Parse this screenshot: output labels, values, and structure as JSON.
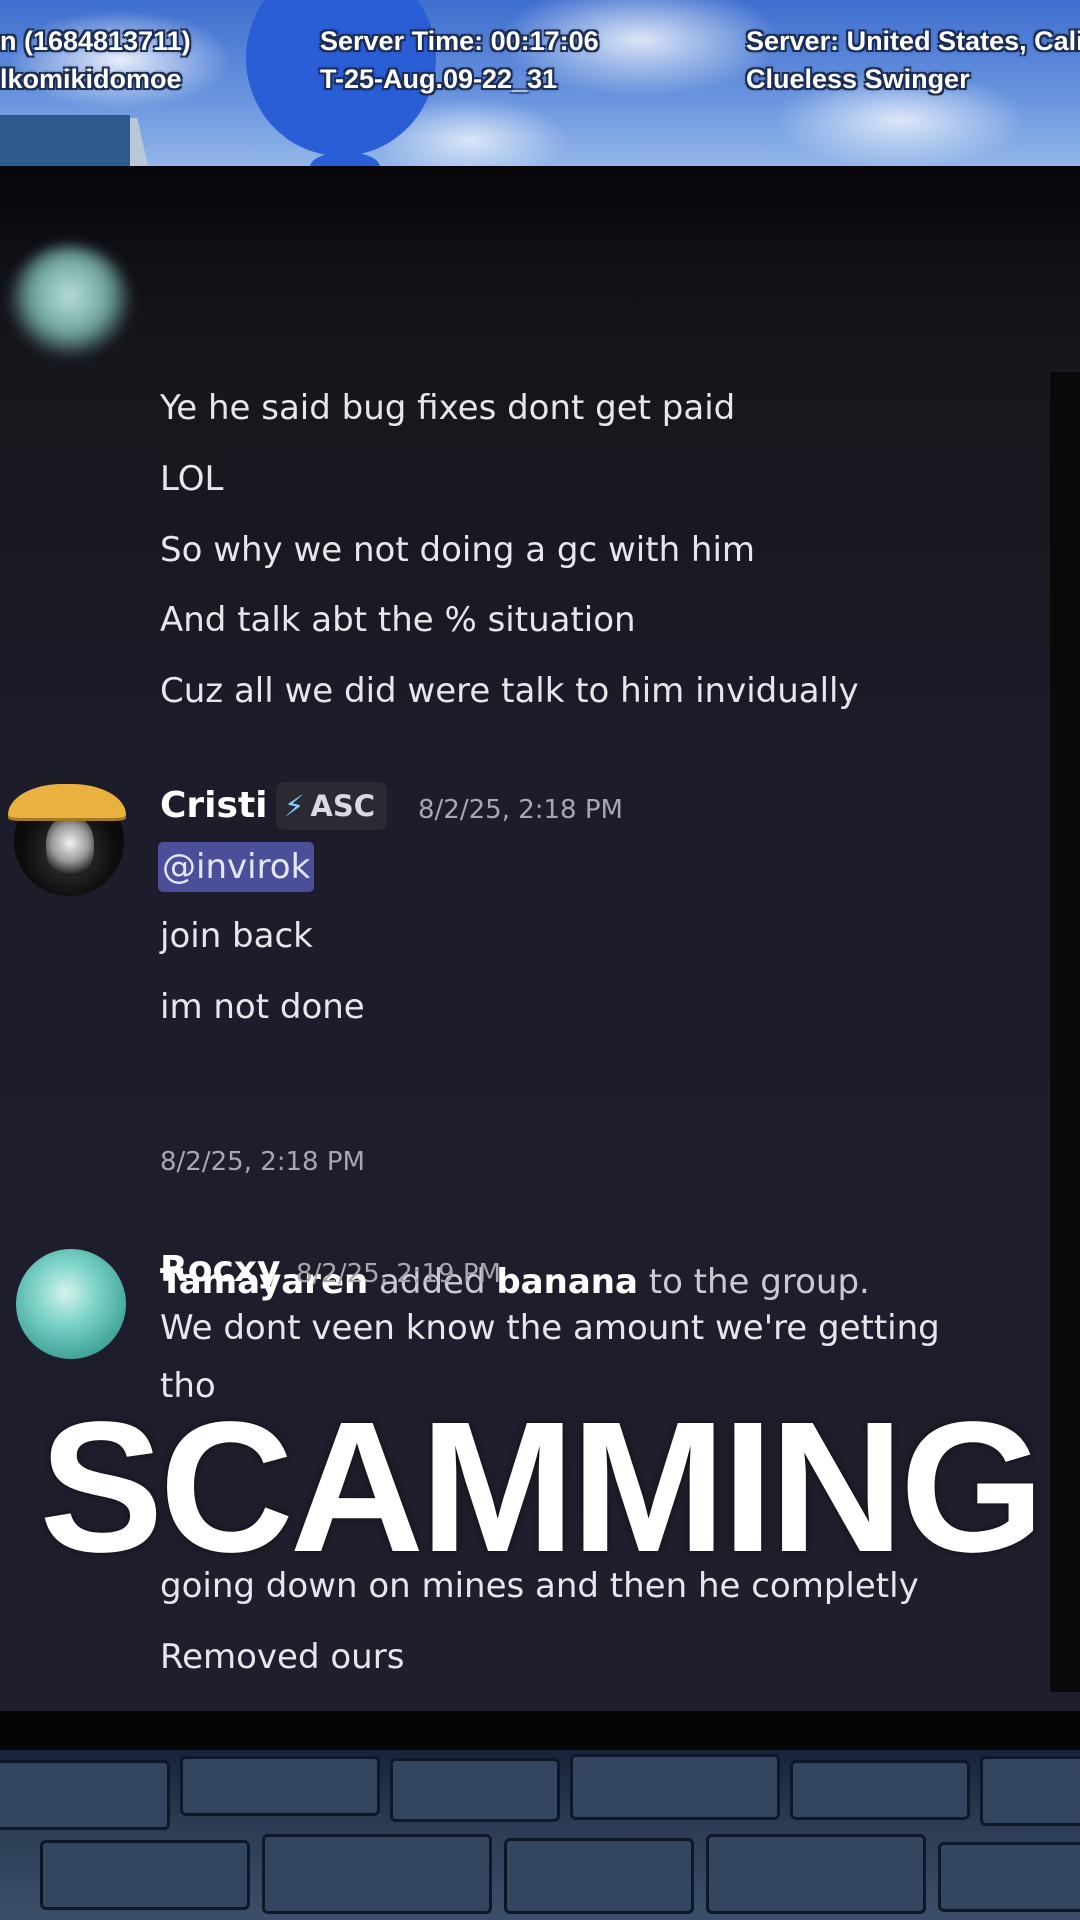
{
  "hud": {
    "left_line1": "n (1684813711)",
    "left_line2": "lkomikidomoe",
    "server_time": "Server Time: 00:17:06",
    "build": "T-25-Aug.09-22_31",
    "server_location": "Server: United States, Calif",
    "mode": "Clueless Swinger"
  },
  "chat": {
    "first_block_lines": [
      "Ye he said bug fixes dont get paid",
      "LOL",
      "So why we not doing a gc with him",
      "And talk abt the % situation",
      "Cuz all we did were talk to him invidually"
    ],
    "cristi": {
      "username": "Cristi",
      "tag": "ASC",
      "timestamp": "8/2/25, 2:18 PM",
      "mention": "@invirok",
      "lines": [
        "join back",
        "im not done"
      ]
    },
    "system": {
      "actor": "Tamayaren",
      "verb": "added",
      "target": "banana",
      "rest": "to the group.",
      "timestamp": "8/2/25, 2:18 PM"
    },
    "rocxy": {
      "username": "Rocxy",
      "timestamp": "8/2/25, 2:19 PM",
      "lines": [
        "We dont veen know the amount we're getting",
        "tho",
        "going down on mines and then he completly",
        "Removed ours"
      ]
    }
  },
  "overlay": {
    "caption": "SCAMMING"
  },
  "colors": {
    "mention_bg": "#4b4f9a",
    "system_arrow": "#3ba55c",
    "chat_bg": "#1f1e2c"
  },
  "icons": {
    "tag_icon": "lightning-bolt-icon",
    "system_icon": "arrow-right-icon"
  }
}
